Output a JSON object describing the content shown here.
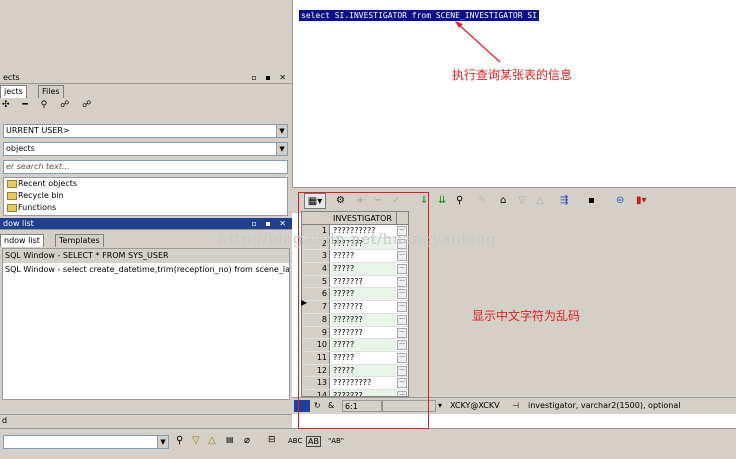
{
  "left_panel": {
    "objects_title": "ects",
    "tabs": [
      "jects",
      "Files"
    ],
    "toolbar_icons": "✣ ━ ⚲ ☍ ☍",
    "user_combo": "URRENT USER>",
    "type_combo": "objects",
    "search_placeholder": "er search text...",
    "tree_items": [
      "Recent objects",
      "Recycle bin",
      "Functions"
    ]
  },
  "window_list": {
    "title": "dow list",
    "tabs": [
      "ndow list",
      "Templates"
    ],
    "rows": [
      "SQL Window - SELECT * FROM SYS_USER",
      "SQL Window - select create_datetime,trim(reception_no) from scene_la"
    ]
  },
  "editor": {
    "sql_text": "select SI.INVESTIGATOR from SCENE_INVESTIGATOR SI"
  },
  "grid": {
    "column_header": "INVESTIGATOR",
    "rows": [
      {
        "num": "1",
        "value": "??????????"
      },
      {
        "num": "2",
        "value": "???????"
      },
      {
        "num": "3",
        "value": "?????"
      },
      {
        "num": "4",
        "value": "?????"
      },
      {
        "num": "5",
        "value": "???????"
      },
      {
        "num": "6",
        "value": "?????"
      },
      {
        "num": "7",
        "value": "???????"
      },
      {
        "num": "8",
        "value": "???????"
      },
      {
        "num": "9",
        "value": "???????"
      },
      {
        "num": "10",
        "value": "?????"
      },
      {
        "num": "11",
        "value": "?????"
      },
      {
        "num": "12",
        "value": "?????"
      },
      {
        "num": "13",
        "value": "?????????"
      },
      {
        "num": "14",
        "value": "???????"
      }
    ]
  },
  "status": {
    "position": "6:1",
    "connection": "XCKY@XCKV",
    "column_info": "investigator, varchar2(1500), optional"
  },
  "bottom": {
    "left_status": "d",
    "abc": "ABC",
    "ab_label": "AB",
    "a_label": "\"AB\""
  },
  "annotations": {
    "query_note": "执行查询某张表的信息",
    "garbled_note": "显示中文字符为乱码",
    "watermark": "http://blog.csdn.net/huangyanlong"
  },
  "colors": {
    "sql_highlight": "#0a0e8a",
    "annotation_red": "#e02020",
    "panel_grey": "#d4d0c8"
  }
}
